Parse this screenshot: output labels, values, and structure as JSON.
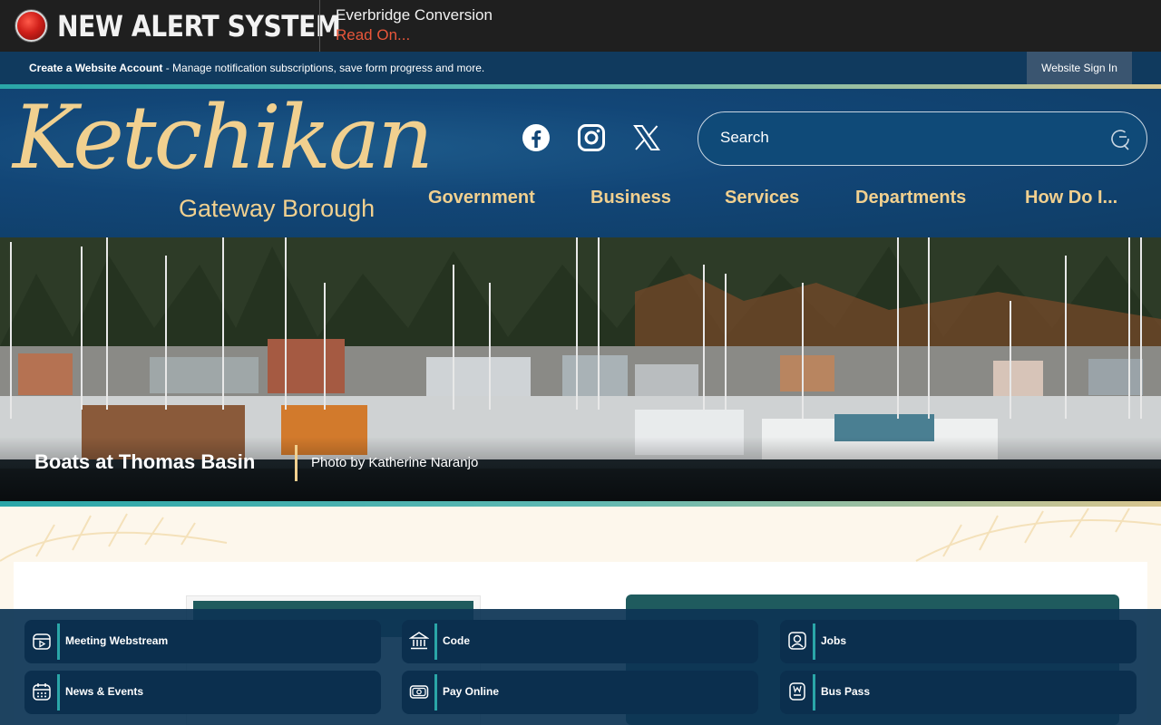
{
  "alert": {
    "title": "NEW ALERT SYSTEM",
    "message": "Everbridge Conversion",
    "read_on": "Read On..."
  },
  "account_bar": {
    "create_account": "Create a Website Account",
    "description": " - Manage notification subscriptions, save form progress and more.",
    "sign_in": "Website Sign In"
  },
  "logo": {
    "script": "Ketchikan",
    "subtitle": "Gateway Borough"
  },
  "social": [
    "facebook-icon",
    "instagram-icon",
    "x-icon"
  ],
  "search": {
    "placeholder": "Search"
  },
  "nav": [
    {
      "label": "Government"
    },
    {
      "label": "Business"
    },
    {
      "label": "Services"
    },
    {
      "label": "Departments"
    },
    {
      "label": "How Do I..."
    }
  ],
  "hero": {
    "caption_title": "Boats at Thomas Basin",
    "caption_credit": "Photo by Katherine Naranjo"
  },
  "quick_links": [
    {
      "label": "Meeting Webstream",
      "icon": "video-calendar-icon"
    },
    {
      "label": "Code",
      "icon": "building-columns-icon"
    },
    {
      "label": "Jobs",
      "icon": "person-badge-icon"
    },
    {
      "label": "News & Events",
      "icon": "calendar-icon"
    },
    {
      "label": "Pay Online",
      "icon": "money-icon"
    },
    {
      "label": "Bus Pass",
      "icon": "bus-pass-icon"
    }
  ],
  "colors": {
    "gold": "#f1d08f",
    "navy": "#0f3d66",
    "teal": "#2aa6a8",
    "alert_red": "#e8563a"
  }
}
